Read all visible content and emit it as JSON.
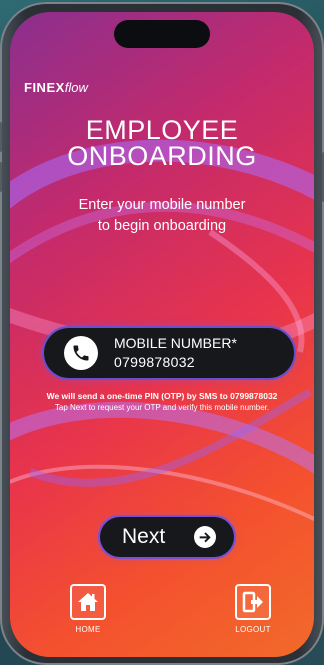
{
  "brand": {
    "logo_main": "FINEX",
    "logo_suffix": "flow"
  },
  "header": {
    "title_line1": "EMPLOYEE",
    "title_line2": "ONBOARDING",
    "subtitle_line1": "Enter your mobile number",
    "subtitle_line2": "to begin onboarding"
  },
  "mobile": {
    "label": "MOBILE NUMBER*",
    "value": "0799878032",
    "icon": "phone-icon"
  },
  "notice": {
    "line1": "We will send a one-time PIN (OTP) by SMS to 0799878032",
    "line2": "Tap Next to request your OTP and verify this mobile number."
  },
  "actions": {
    "next_label": "Next",
    "next_icon": "arrow-right-icon"
  },
  "bottom_nav": {
    "home_label": "HOME",
    "home_icon": "home-icon",
    "logout_label": "LOGOUT",
    "logout_icon": "logout-icon"
  },
  "colors": {
    "accent_purple": "#6a4fc9",
    "pill_background": "#17181b",
    "gradient_start": "#8b2f8f",
    "gradient_end": "#f16a2a"
  }
}
